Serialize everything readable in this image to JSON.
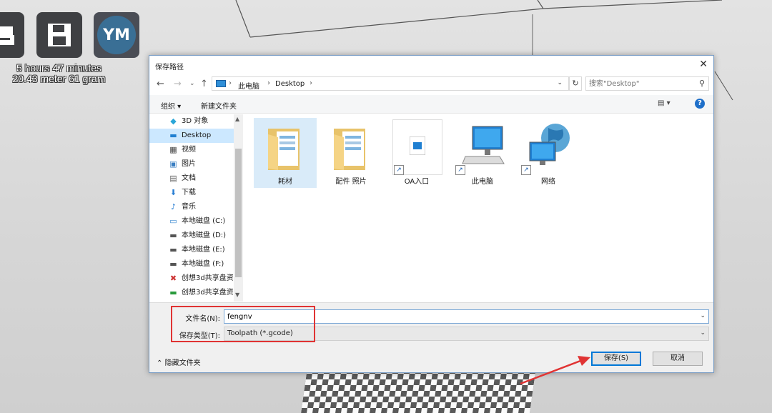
{
  "toolbar": {
    "open_icon": "open-file-icon",
    "save_icon": "save-disk-icon",
    "account_label": "YM"
  },
  "print_info": {
    "time": "5 hours 47 minutes",
    "material": "20.43 meter 61 gram"
  },
  "dialog": {
    "title": "保存路径",
    "close": "✕",
    "address": {
      "segments": [
        "此电脑",
        "Desktop"
      ],
      "separator": "›"
    },
    "search_placeholder": "搜索\"Desktop\"",
    "commands": {
      "organize": "组织 ▾",
      "new_folder": "新建文件夹"
    },
    "nav_items": [
      {
        "label": "3D 对象",
        "icon": "3d-objects-icon",
        "selected": false
      },
      {
        "label": "Desktop",
        "icon": "desktop-icon",
        "selected": true
      },
      {
        "label": "视频",
        "icon": "video-icon",
        "selected": false
      },
      {
        "label": "图片",
        "icon": "pictures-icon",
        "selected": false
      },
      {
        "label": "文档",
        "icon": "documents-icon",
        "selected": false
      },
      {
        "label": "下载",
        "icon": "downloads-icon",
        "selected": false
      },
      {
        "label": "音乐",
        "icon": "music-icon",
        "selected": false
      },
      {
        "label": "本地磁盘 (C:)",
        "icon": "drive-icon",
        "selected": false
      },
      {
        "label": "本地磁盘 (D:)",
        "icon": "drive-icon",
        "selected": false
      },
      {
        "label": "本地磁盘 (E:)",
        "icon": "drive-icon",
        "selected": false
      },
      {
        "label": "本地磁盘 (F:)",
        "icon": "drive-icon",
        "selected": false
      },
      {
        "label": "创想3d共享盘资",
        "icon": "network-drive-disconnected-icon",
        "selected": false
      },
      {
        "label": "创想3d共享盘资",
        "icon": "network-drive-icon",
        "selected": false
      }
    ],
    "files": [
      {
        "label": "耗材",
        "icon": "folder-icon",
        "selected": true
      },
      {
        "label": "配件 照片",
        "icon": "folder-icon",
        "selected": false
      },
      {
        "label": "OA入口",
        "icon": "shortcut-file-icon",
        "selected": false
      },
      {
        "label": "此电脑",
        "icon": "computer-icon",
        "selected": false
      },
      {
        "label": "网络",
        "icon": "network-icon",
        "selected": false
      }
    ],
    "file_name_label": "文件名(N):",
    "file_name_value": "fengnv",
    "file_type_label": "保存类型(T):",
    "file_type_value": "Toolpath (*.gcode)",
    "hide_folders": "隐藏文件夹",
    "save_button": "保存(S)",
    "cancel_button": "取消",
    "help": "?"
  },
  "annotations": {
    "highlight_color": "#e03333"
  }
}
